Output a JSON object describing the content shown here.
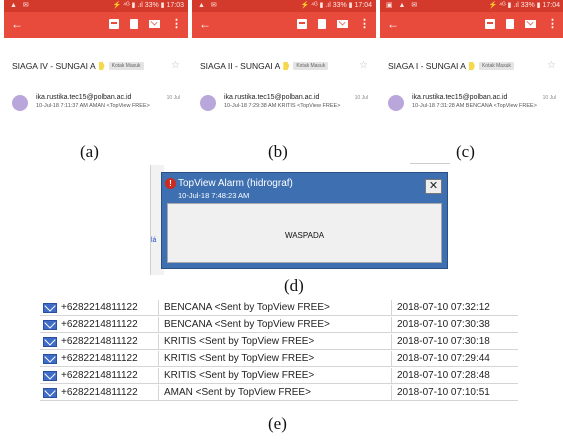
{
  "panels": [
    {
      "status_left": "▲ ✉",
      "status_right": "⚡ ⁴ᴳ ▮ .ıl 33% ▮ 17:03",
      "subject": "SIAGA IV - SUNGAI A",
      "label": "Kotak Masuk",
      "sender": "ika.rustika.tec15@polban.ac.id",
      "date": "10 Jul",
      "preview": "10-Jul-18 7:11:37 AM AMAN <TopView FREE>",
      "caption": "(a)"
    },
    {
      "status_left": "▲ ✉",
      "status_right": "⚡ ⁴ᴳ ▮ .ıl 33% ▮ 17:04",
      "subject": "SIAGA II - SUNGAI A",
      "label": "Kotak Masuk",
      "sender": "ika.rustika.tec15@polban.ac.id",
      "date": "10 Jul",
      "preview": "10-Jul-18 7:29:38 AM KRITIS <TopView FREE>",
      "caption": "(b)"
    },
    {
      "status_left": "▣ ▲ ✉",
      "status_right": "⚡ ⁴ᴳ ▮ .ıl 33% ▮ 17:04",
      "subject": "SIAGA I - SUNGAI A",
      "label": "Kotak Masuk",
      "sender": "ika.rustika.tec15@polban.ac.id",
      "date": "10 Jul",
      "preview": "10-Jul-18 7:31:28 AM BENCANA <TopView FREE>",
      "caption": "(c)"
    }
  ],
  "icons": {
    "back": "←",
    "more": "⋮",
    "star": "☆",
    "close": "✕",
    "alarm": "!"
  },
  "alarm": {
    "title": "TopView Alarm (hidrograf)",
    "time": "10-Jul-18 7:48:23 AM",
    "message": "WASPADA",
    "caption": "(d)"
  },
  "sms_log": {
    "rows": [
      {
        "phone": "+6282214811122",
        "message": "BENCANA <Sent by TopView FREE>",
        "datetime": "2018-07-10 07:32:12"
      },
      {
        "phone": "+6282214811122",
        "message": "BENCANA <Sent by TopView FREE>",
        "datetime": "2018-07-10 07:30:38"
      },
      {
        "phone": "+6282214811122",
        "message": "KRITIS <Sent by TopView FREE>",
        "datetime": "2018-07-10 07:30:18"
      },
      {
        "phone": "+6282214811122",
        "message": "KRITIS <Sent by TopView FREE>",
        "datetime": "2018-07-10 07:29:44"
      },
      {
        "phone": "+6282214811122",
        "message": "KRITIS <Sent by TopView FREE>",
        "datetime": "2018-07-10 07:28:48"
      },
      {
        "phone": "+6282214811122",
        "message": "AMAN <Sent by TopView FREE>",
        "datetime": "2018-07-10 07:10:51"
      }
    ],
    "caption": "(e)"
  },
  "colors": {
    "gmail_red": "#e84b3c",
    "status_red": "#d43a2c",
    "alarm_blue": "#3d6fb1",
    "envelope_blue": "#3f6cc8"
  }
}
